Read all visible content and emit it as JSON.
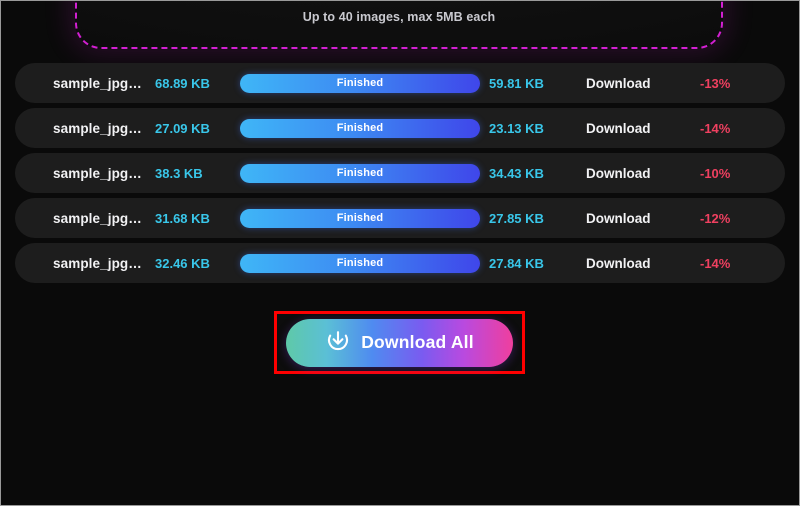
{
  "dropzone": {
    "hint": "Up to 40 images, max 5MB each",
    "border_color": "#d21fd2"
  },
  "file_list": {
    "progress_label": "Finished",
    "download_label": "Download",
    "size_color": "#39c7ea",
    "delta_color": "#ef4060",
    "rows": [
      {
        "name": "sample_jpg…",
        "size_before": "68.89 KB",
        "status": "Finished",
        "size_after": "59.81 KB",
        "download": "Download",
        "delta": "-13%"
      },
      {
        "name": "sample_jpg…",
        "size_before": "27.09 KB",
        "status": "Finished",
        "size_after": "23.13 KB",
        "download": "Download",
        "delta": "-14%"
      },
      {
        "name": "sample_jpg…",
        "size_before": "38.3 KB",
        "status": "Finished",
        "size_after": "34.43 KB",
        "download": "Download",
        "delta": "-10%"
      },
      {
        "name": "sample_jpg…",
        "size_before": "31.68 KB",
        "status": "Finished",
        "size_after": "27.85 KB",
        "download": "Download",
        "delta": "-12%"
      },
      {
        "name": "sample_jpg…",
        "size_before": "32.46 KB",
        "status": "Finished",
        "size_after": "27.84 KB",
        "download": "Download",
        "delta": "-14%"
      }
    ]
  },
  "download_all": {
    "label": "Download All",
    "icon": "download-circle-icon",
    "highlight_color": "#ff0000"
  }
}
